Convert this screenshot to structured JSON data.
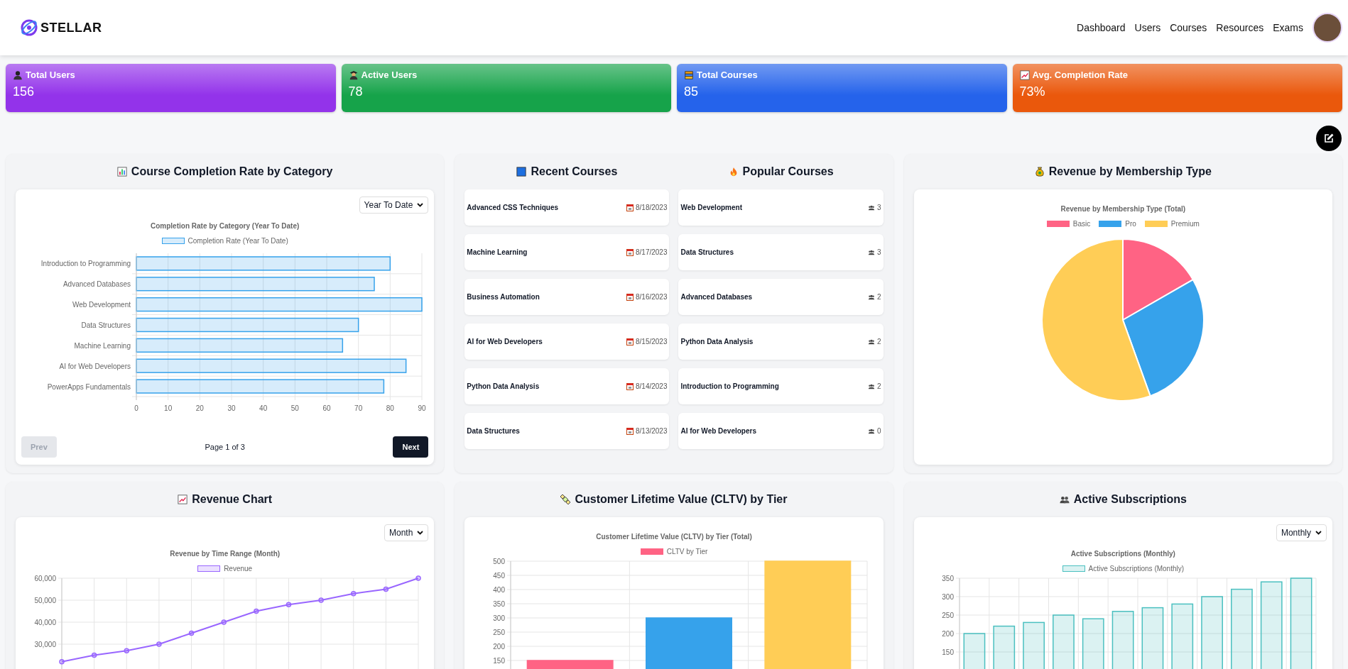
{
  "header": {
    "logo": "STELLAR",
    "nav": [
      "Dashboard",
      "Users",
      "Courses",
      "Resources",
      "Exams"
    ]
  },
  "stats": [
    {
      "label": "Total Users",
      "value": "156",
      "color": "#9333ea"
    },
    {
      "label": "Active Users",
      "value": "78",
      "color": "#16a34a"
    },
    {
      "label": "Total Courses",
      "value": "85",
      "color": "#2563eb"
    },
    {
      "label": "Avg. Completion Rate",
      "value": "73%",
      "color": "#ea580c"
    }
  ],
  "completion_card": {
    "title": "Course Completion Rate by Category",
    "range": "Year To Date",
    "chart_data": {
      "type": "bar",
      "orientation": "horizontal",
      "title": "Completion Rate by Category (Year To Date)",
      "categories": [
        "Introduction to Programming",
        "Advanced Databases",
        "Web Development",
        "Data Structures",
        "Machine Learning",
        "AI for Web Developers",
        "PowerApps Fundamentals"
      ],
      "series": [
        {
          "name": "Completion Rate (Year To Date)",
          "color": "#36a2eb",
          "values": [
            80,
            75,
            90,
            70,
            65,
            85,
            78
          ]
        }
      ],
      "xlim": [
        0,
        90
      ],
      "xticks": [
        0,
        10,
        20,
        30,
        40,
        50,
        60,
        70,
        80,
        90
      ],
      "grid": true,
      "legend": "top"
    },
    "pagination": {
      "prev": "Prev",
      "prev_disabled": true,
      "page": "Page 1 of 3",
      "next": "Next"
    }
  },
  "recent_courses": {
    "title": "Recent Courses",
    "items": [
      {
        "name": "Advanced CSS Techniques",
        "date": "8/18/2023"
      },
      {
        "name": "Machine Learning",
        "date": "8/17/2023"
      },
      {
        "name": "Business Automation",
        "date": "8/16/2023"
      },
      {
        "name": "AI for Web Developers",
        "date": "8/15/2023"
      },
      {
        "name": "Python Data Analysis",
        "date": "8/14/2023"
      },
      {
        "name": "Data Structures",
        "date": "8/13/2023"
      }
    ]
  },
  "popular_courses": {
    "title": "Popular Courses",
    "items": [
      {
        "name": "Web Development",
        "count": "3"
      },
      {
        "name": "Data Structures",
        "count": "3"
      },
      {
        "name": "Advanced Databases",
        "count": "2"
      },
      {
        "name": "Python Data Analysis",
        "count": "2"
      },
      {
        "name": "Introduction to Programming",
        "count": "2"
      },
      {
        "name": "AI for Web Developers",
        "count": "0"
      }
    ]
  },
  "membership_card": {
    "title": "Revenue by Membership Type",
    "chart_data": {
      "type": "pie",
      "title": "Revenue by Membership Type (Total)",
      "categories": [
        "Basic",
        "Pro",
        "Premium"
      ],
      "values": [
        16.7,
        27.8,
        55.5
      ],
      "colors": [
        "#ff6384",
        "#36a2eb",
        "#ffcd56"
      ],
      "legend": "top"
    }
  },
  "revenue_card": {
    "title": "Revenue Chart",
    "range": "Month",
    "chart_data": {
      "type": "line",
      "title": "Revenue by Time Range (Month)",
      "series": [
        {
          "name": "Revenue",
          "color": "#9966ff",
          "marker": "circle",
          "values": [
            22000,
            25000,
            27000,
            30000,
            35000,
            40000,
            45000,
            48000,
            50000,
            53000,
            55000,
            60000
          ]
        }
      ],
      "grid": true,
      "legend": "top",
      "ylim": [
        0,
        60000
      ],
      "yticks": [
        {
          "value": 30000,
          "label": "30,000"
        },
        {
          "value": 40000,
          "label": "40,000"
        },
        {
          "value": 50000,
          "label": "50,000"
        },
        {
          "value": 60000,
          "label": "60,000"
        }
      ]
    }
  },
  "cltv_card": {
    "title": "Customer Lifetime Value (CLTV) by Tier",
    "chart_data": {
      "type": "bar",
      "title": "Customer Lifetime Value (CLTV) by Tier (Total)",
      "series": [
        {
          "name": "CLTV by Tier",
          "values": [
            150,
            300,
            500
          ]
        }
      ],
      "colors": [
        "#ff6384",
        "#36a2eb",
        "#ffcd56"
      ],
      "grid": true,
      "legend": "top",
      "ylim": [
        0,
        500
      ],
      "yticks": [
        150,
        200,
        250,
        300,
        350,
        400,
        450,
        500
      ]
    }
  },
  "subscriptions_card": {
    "title": "Active Subscriptions",
    "range": "Monthly",
    "chart_data": {
      "type": "bar",
      "title": "Active Subscriptions (Monthly)",
      "series": [
        {
          "name": "Active Subscriptions (Monthly)",
          "color": "#4bc0c0",
          "values": [
            200,
            220,
            230,
            250,
            240,
            260,
            270,
            280,
            300,
            320,
            340,
            350
          ]
        }
      ],
      "grid": true,
      "legend": "top",
      "ylim": [
        0,
        350
      ],
      "yticks": [
        150,
        200,
        250,
        300,
        350
      ]
    }
  }
}
